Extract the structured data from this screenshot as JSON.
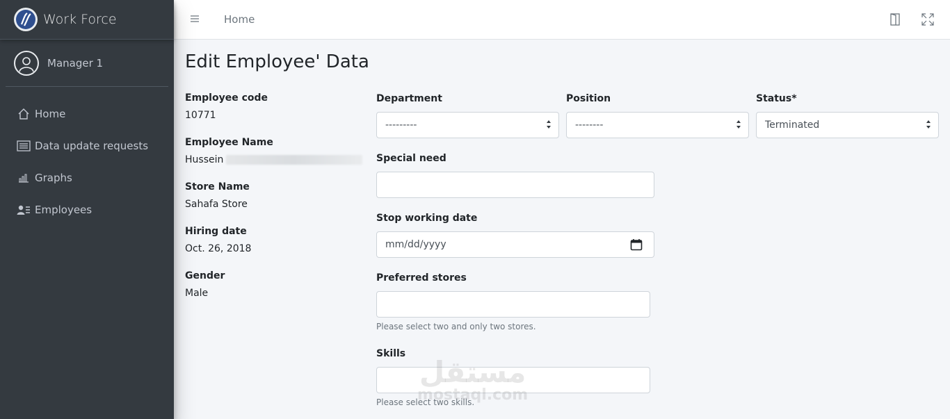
{
  "brand": {
    "name": "Work Force"
  },
  "user": {
    "name": "Manager 1"
  },
  "sidebar": {
    "items": [
      {
        "label": "Home",
        "icon": "home-icon"
      },
      {
        "label": "Data update requests",
        "icon": "list-icon"
      },
      {
        "label": "Graphs",
        "icon": "bar-chart-icon"
      },
      {
        "label": "Employees",
        "icon": "users-icon"
      }
    ]
  },
  "topbar": {
    "home_link": "Home",
    "icons": [
      "menu-icon",
      "door-icon",
      "fullscreen-icon"
    ]
  },
  "page": {
    "title": "Edit Employee' Data"
  },
  "employee": {
    "code_label": "Employee code",
    "code": "10771",
    "name_label": "Employee Name",
    "name": "Hussein",
    "store_label": "Store Name",
    "store": "Sahafa Store",
    "hiring_label": "Hiring date",
    "hiring": "Oct. 26, 2018",
    "gender_label": "Gender",
    "gender": "Male"
  },
  "form": {
    "department": {
      "label": "Department",
      "value": "---------"
    },
    "position": {
      "label": "Position",
      "value": "--------"
    },
    "status": {
      "label": "Status*",
      "value": "Terminated"
    },
    "special_need": {
      "label": "Special need",
      "value": ""
    },
    "stop_date": {
      "label": "Stop working date",
      "placeholder": "mm/dd/yyyy"
    },
    "preferred_stores": {
      "label": "Preferred stores",
      "help": "Please select two and only two stores."
    },
    "skills": {
      "label": "Skills",
      "help": "Please select two skills."
    }
  },
  "watermark": {
    "arabic": "مستقل",
    "latin": "mostaql.com"
  },
  "colors": {
    "sidebar": "#343a40",
    "sidebar_text": "#c2c7d0",
    "content_bg": "#f4f6f9"
  }
}
